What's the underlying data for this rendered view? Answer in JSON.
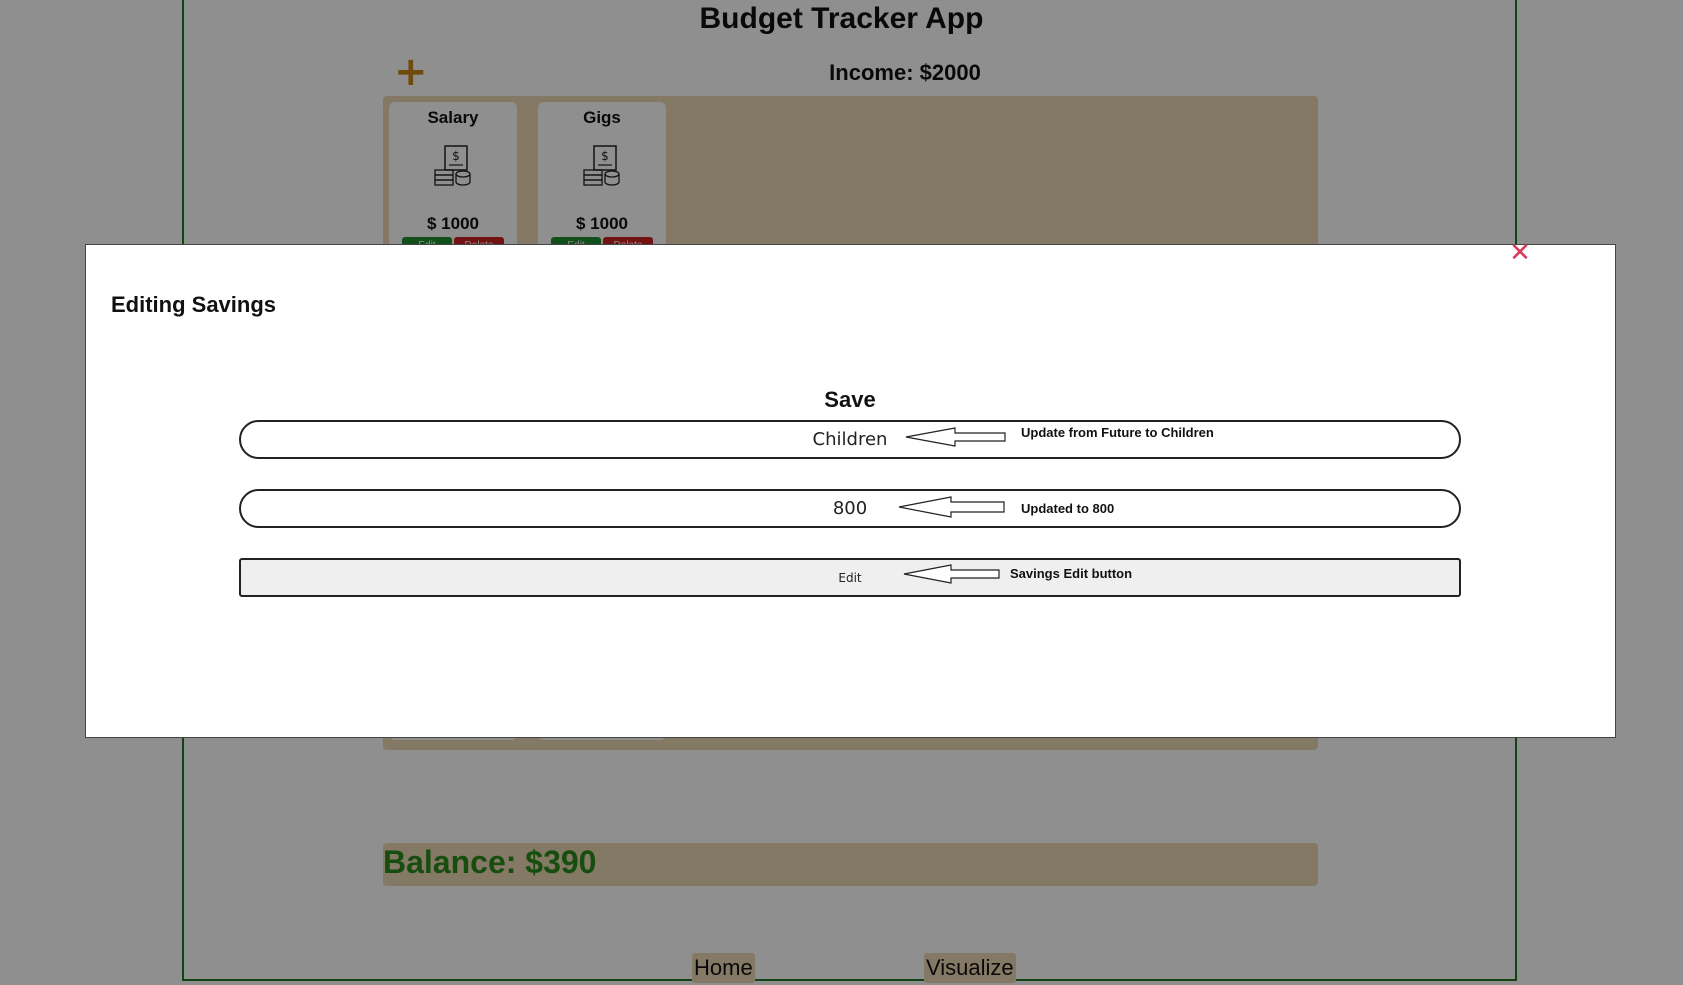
{
  "app": {
    "title": "Budget Tracker App",
    "add_icon": "plus-icon",
    "accent_color": "#c8871a"
  },
  "income": {
    "label": "Income: $2000",
    "cards": [
      {
        "name": "Salary",
        "icon": "money-document-icon",
        "amount": "$ 1000",
        "edit_label": "Edit",
        "delete_label": "Delete"
      },
      {
        "name": "Gigs",
        "icon": "money-document-icon",
        "amount": "$ 1000",
        "edit_label": "Edit",
        "delete_label": "Delete"
      }
    ]
  },
  "balance": {
    "label": "Balance: $390",
    "color": "#2a8a1a"
  },
  "nav": {
    "home": "Home",
    "visualize": "Visualize"
  },
  "modal": {
    "title": "Editing Savings",
    "close_icon": "close-icon",
    "heading": "Save",
    "name_value": "Children",
    "amount_value": "800",
    "edit_button": "Edit"
  },
  "annotations": {
    "name_note": "Update from Future to Children",
    "amount_note": "Updated to 800",
    "button_note": "Savings Edit button"
  }
}
